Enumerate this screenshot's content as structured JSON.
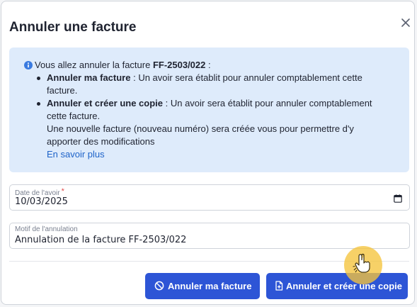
{
  "dialog": {
    "title": "Annuler une facture",
    "close_icon": "close-icon"
  },
  "info": {
    "icon": "info-icon",
    "intro_prefix": "Vous allez annuler la facture ",
    "invoice_number": "FF-2503/022",
    "intro_suffix": " :",
    "items": [
      {
        "label": "Annuler ma facture",
        "text_line1": " : Un avoir sera établit pour annuler comptablement cette",
        "text_line2": "facture."
      },
      {
        "label": "Annuler et créer une copie",
        "text_line1": " : Un avoir sera établit pour annuler comptablement",
        "text_line2": "cette facture.",
        "text_line3": "Une nouvelle facture (nouveau numéro) sera créée vous pour permettre d'y",
        "text_line4": "apporter des modifications"
      }
    ],
    "learn_more": "En savoir plus"
  },
  "form": {
    "date": {
      "label": "Date de l'avoir",
      "required_mark": "*",
      "value": "10/03/2025",
      "icon": "calendar-icon"
    },
    "motif": {
      "label": "Motif de l'annulation",
      "value": "Annulation de la facture FF-2503/022"
    }
  },
  "actions": {
    "cancel_invoice": {
      "label": "Annuler ma facture",
      "icon": "ban-icon"
    },
    "cancel_and_copy": {
      "label": "Annuler et créer une copie",
      "icon": "document-plus-icon"
    }
  },
  "colors": {
    "primary_button": "#2d55d6",
    "info_background": "#deebfb",
    "link": "#1e63c9",
    "required": "#e04848",
    "cursor_highlight": "#f5c43c"
  }
}
